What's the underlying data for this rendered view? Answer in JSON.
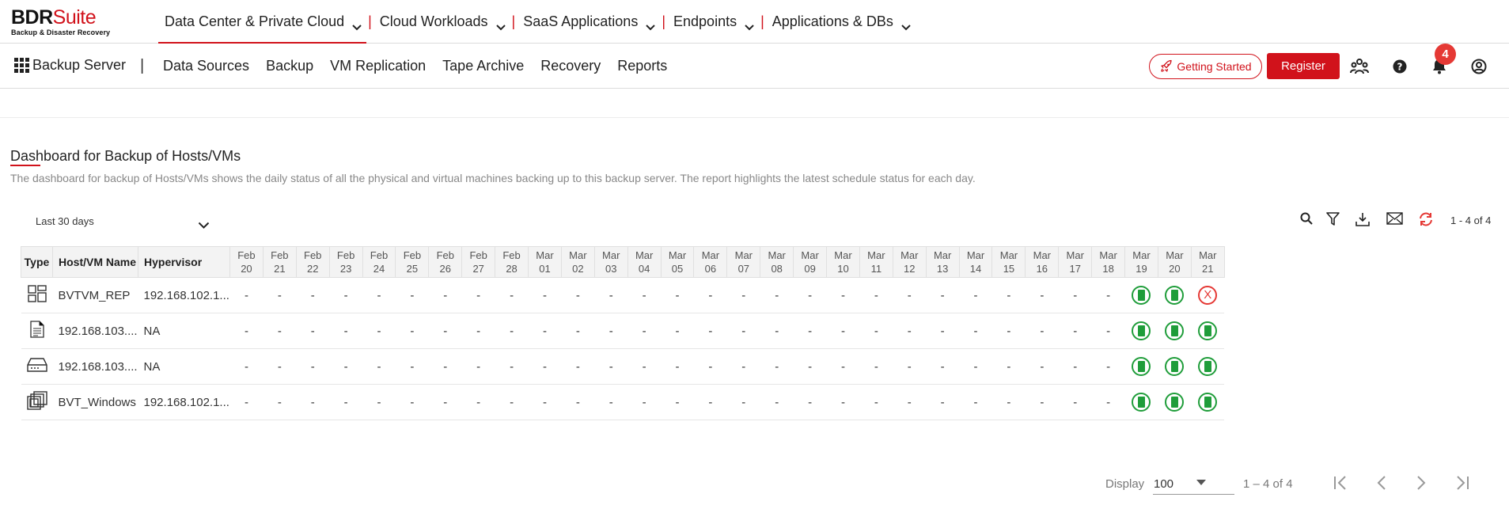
{
  "brand": {
    "name_bold": "BDR",
    "name_light": "Suite",
    "tagline": "Backup & Disaster Recovery",
    "accent": "#d1121b"
  },
  "topnav": [
    {
      "label": "Data Center & Private Cloud",
      "active": true
    },
    {
      "label": "Cloud Workloads"
    },
    {
      "label": "SaaS Applications"
    },
    {
      "label": "Endpoints"
    },
    {
      "label": "Applications & DBs"
    }
  ],
  "topnav_sep": "|",
  "subbar": {
    "server_label": "Backup Server",
    "separator": "|",
    "items": [
      "Data Sources",
      "Backup",
      "VM Replication",
      "Tape Archive",
      "Recovery",
      "Reports"
    ],
    "getting_started": "Getting Started",
    "register": "Register",
    "notification_count": "4"
  },
  "page": {
    "title": "Dashboard for Backup of Hosts/VMs",
    "description": "The dashboard for backup of Hosts/VMs shows the daily status of all the physical and virtual machines backing up to this backup server. The report highlights the latest schedule status for each day."
  },
  "filter": {
    "range": "Last 30 days",
    "pager": "1 - 4 of 4"
  },
  "table": {
    "columns": [
      "Type",
      "Host/VM Name",
      "Hypervisor"
    ],
    "dates": [
      [
        "Feb",
        "20"
      ],
      [
        "Feb",
        "21"
      ],
      [
        "Feb",
        "22"
      ],
      [
        "Feb",
        "23"
      ],
      [
        "Feb",
        "24"
      ],
      [
        "Feb",
        "25"
      ],
      [
        "Feb",
        "26"
      ],
      [
        "Feb",
        "27"
      ],
      [
        "Feb",
        "28"
      ],
      [
        "Mar",
        "01"
      ],
      [
        "Mar",
        "02"
      ],
      [
        "Mar",
        "03"
      ],
      [
        "Mar",
        "04"
      ],
      [
        "Mar",
        "05"
      ],
      [
        "Mar",
        "06"
      ],
      [
        "Mar",
        "07"
      ],
      [
        "Mar",
        "08"
      ],
      [
        "Mar",
        "09"
      ],
      [
        "Mar",
        "10"
      ],
      [
        "Mar",
        "11"
      ],
      [
        "Mar",
        "12"
      ],
      [
        "Mar",
        "13"
      ],
      [
        "Mar",
        "14"
      ],
      [
        "Mar",
        "15"
      ],
      [
        "Mar",
        "16"
      ],
      [
        "Mar",
        "17"
      ],
      [
        "Mar",
        "18"
      ],
      [
        "Mar",
        "19"
      ],
      [
        "Mar",
        "20"
      ],
      [
        "Mar",
        "21"
      ]
    ],
    "rows": [
      {
        "type_icon": "hyper-v-icon",
        "name": "BVTVM_REP",
        "hypervisor": "192.168.102.1...",
        "last3": [
          "ok",
          "ok",
          "fail"
        ]
      },
      {
        "type_icon": "file-server-icon",
        "name": "192.168.103....",
        "hypervisor": "NA",
        "last3": [
          "ok",
          "ok",
          "ok"
        ]
      },
      {
        "type_icon": "storage-device-icon",
        "name": "192.168.103....",
        "hypervisor": "NA",
        "last3": [
          "ok",
          "ok",
          "ok"
        ]
      },
      {
        "type_icon": "vm-stack-icon",
        "name": "BVT_Windows",
        "hypervisor": "192.168.102.1...",
        "last3": [
          "ok",
          "ok",
          "ok"
        ]
      }
    ],
    "empty_mark": "-",
    "fail_mark": "X"
  },
  "footer": {
    "display_label": "Display",
    "display_value": "100",
    "range": "1 – 4 of 4"
  }
}
